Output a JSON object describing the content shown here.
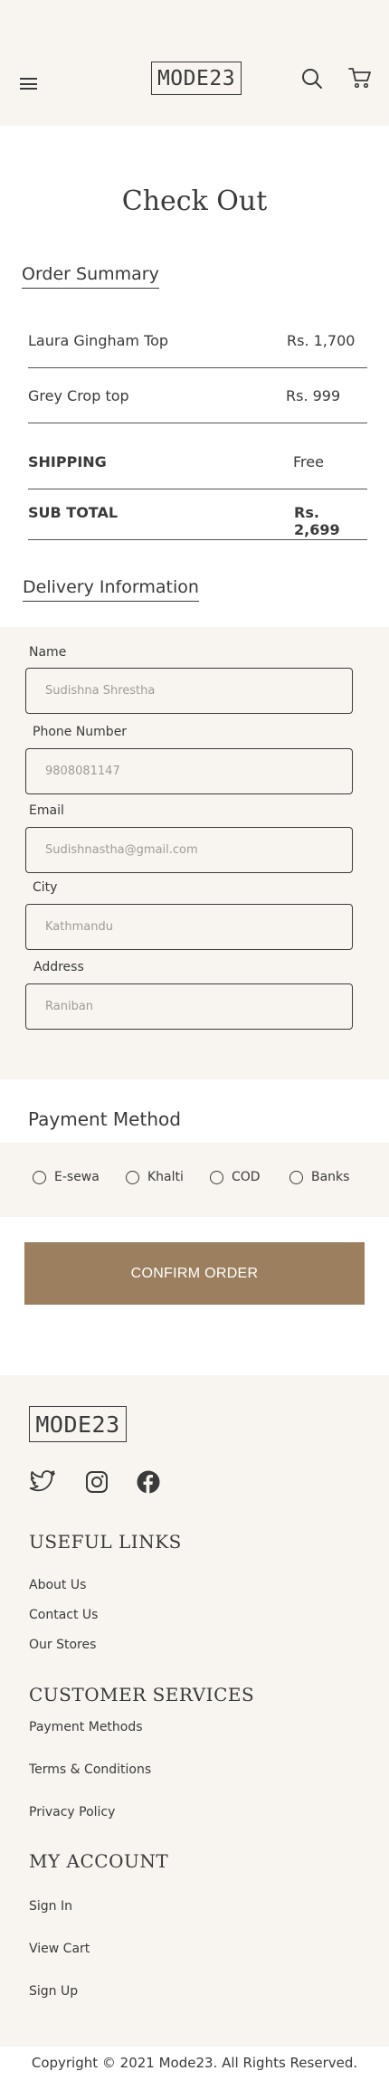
{
  "header": {
    "brand": "MODE23",
    "menu_icon": "hamburger-menu-icon",
    "search_icon": "search-icon",
    "cart_icon": "shopping-cart-icon"
  },
  "page": {
    "title": "Check Out"
  },
  "order_summary": {
    "heading": "Order Summary",
    "items": [
      {
        "name": "Laura Gingham Top",
        "price": "Rs. 1,700"
      },
      {
        "name": "Grey Crop top",
        "price": "Rs. 999"
      }
    ],
    "shipping_label": "SHIPPING",
    "shipping_value": "Free",
    "subtotal_label": "SUB TOTAL",
    "subtotal_value": "Rs. 2,699"
  },
  "delivery": {
    "heading": "Delivery Information",
    "name": {
      "label": "Name",
      "placeholder": "Sudishna Shrestha"
    },
    "phone": {
      "label": "Phone Number",
      "placeholder": "9808081147"
    },
    "email": {
      "label": "Email",
      "placeholder": "Sudishnastha@gmail.com"
    },
    "city": {
      "label": "City",
      "placeholder": "Kathmandu"
    },
    "address": {
      "label": "Address",
      "placeholder": "Raniban"
    }
  },
  "payment": {
    "heading": "Payment Method",
    "options": [
      "E-sewa",
      "Khalti",
      "COD",
      "Banks"
    ]
  },
  "confirm_label": "CONFIRM ORDER",
  "footer": {
    "brand": "MODE23",
    "social_icons": [
      "twitter-icon",
      "instagram-icon",
      "facebook-icon"
    ],
    "useful_links": {
      "heading": "USEFUL LINKS",
      "links": [
        "About Us",
        "Contact Us",
        "Our Stores"
      ]
    },
    "customer_services": {
      "heading": "CUSTOMER SERVICES",
      "links": [
        "Payment Methods",
        "Terms & Conditions",
        "Privacy Policy"
      ]
    },
    "my_account": {
      "heading": "MY ACCOUNT",
      "links": [
        "Sign In",
        "View Cart",
        "Sign Up"
      ]
    },
    "copyright": "Copyright © 2021 Mode23. All Rights Reserved."
  },
  "colors": {
    "accent": "#9b7f5f",
    "panel_bg": "#f8f5f1",
    "text": "#3a3a3a",
    "placeholder": "#a09a92"
  }
}
